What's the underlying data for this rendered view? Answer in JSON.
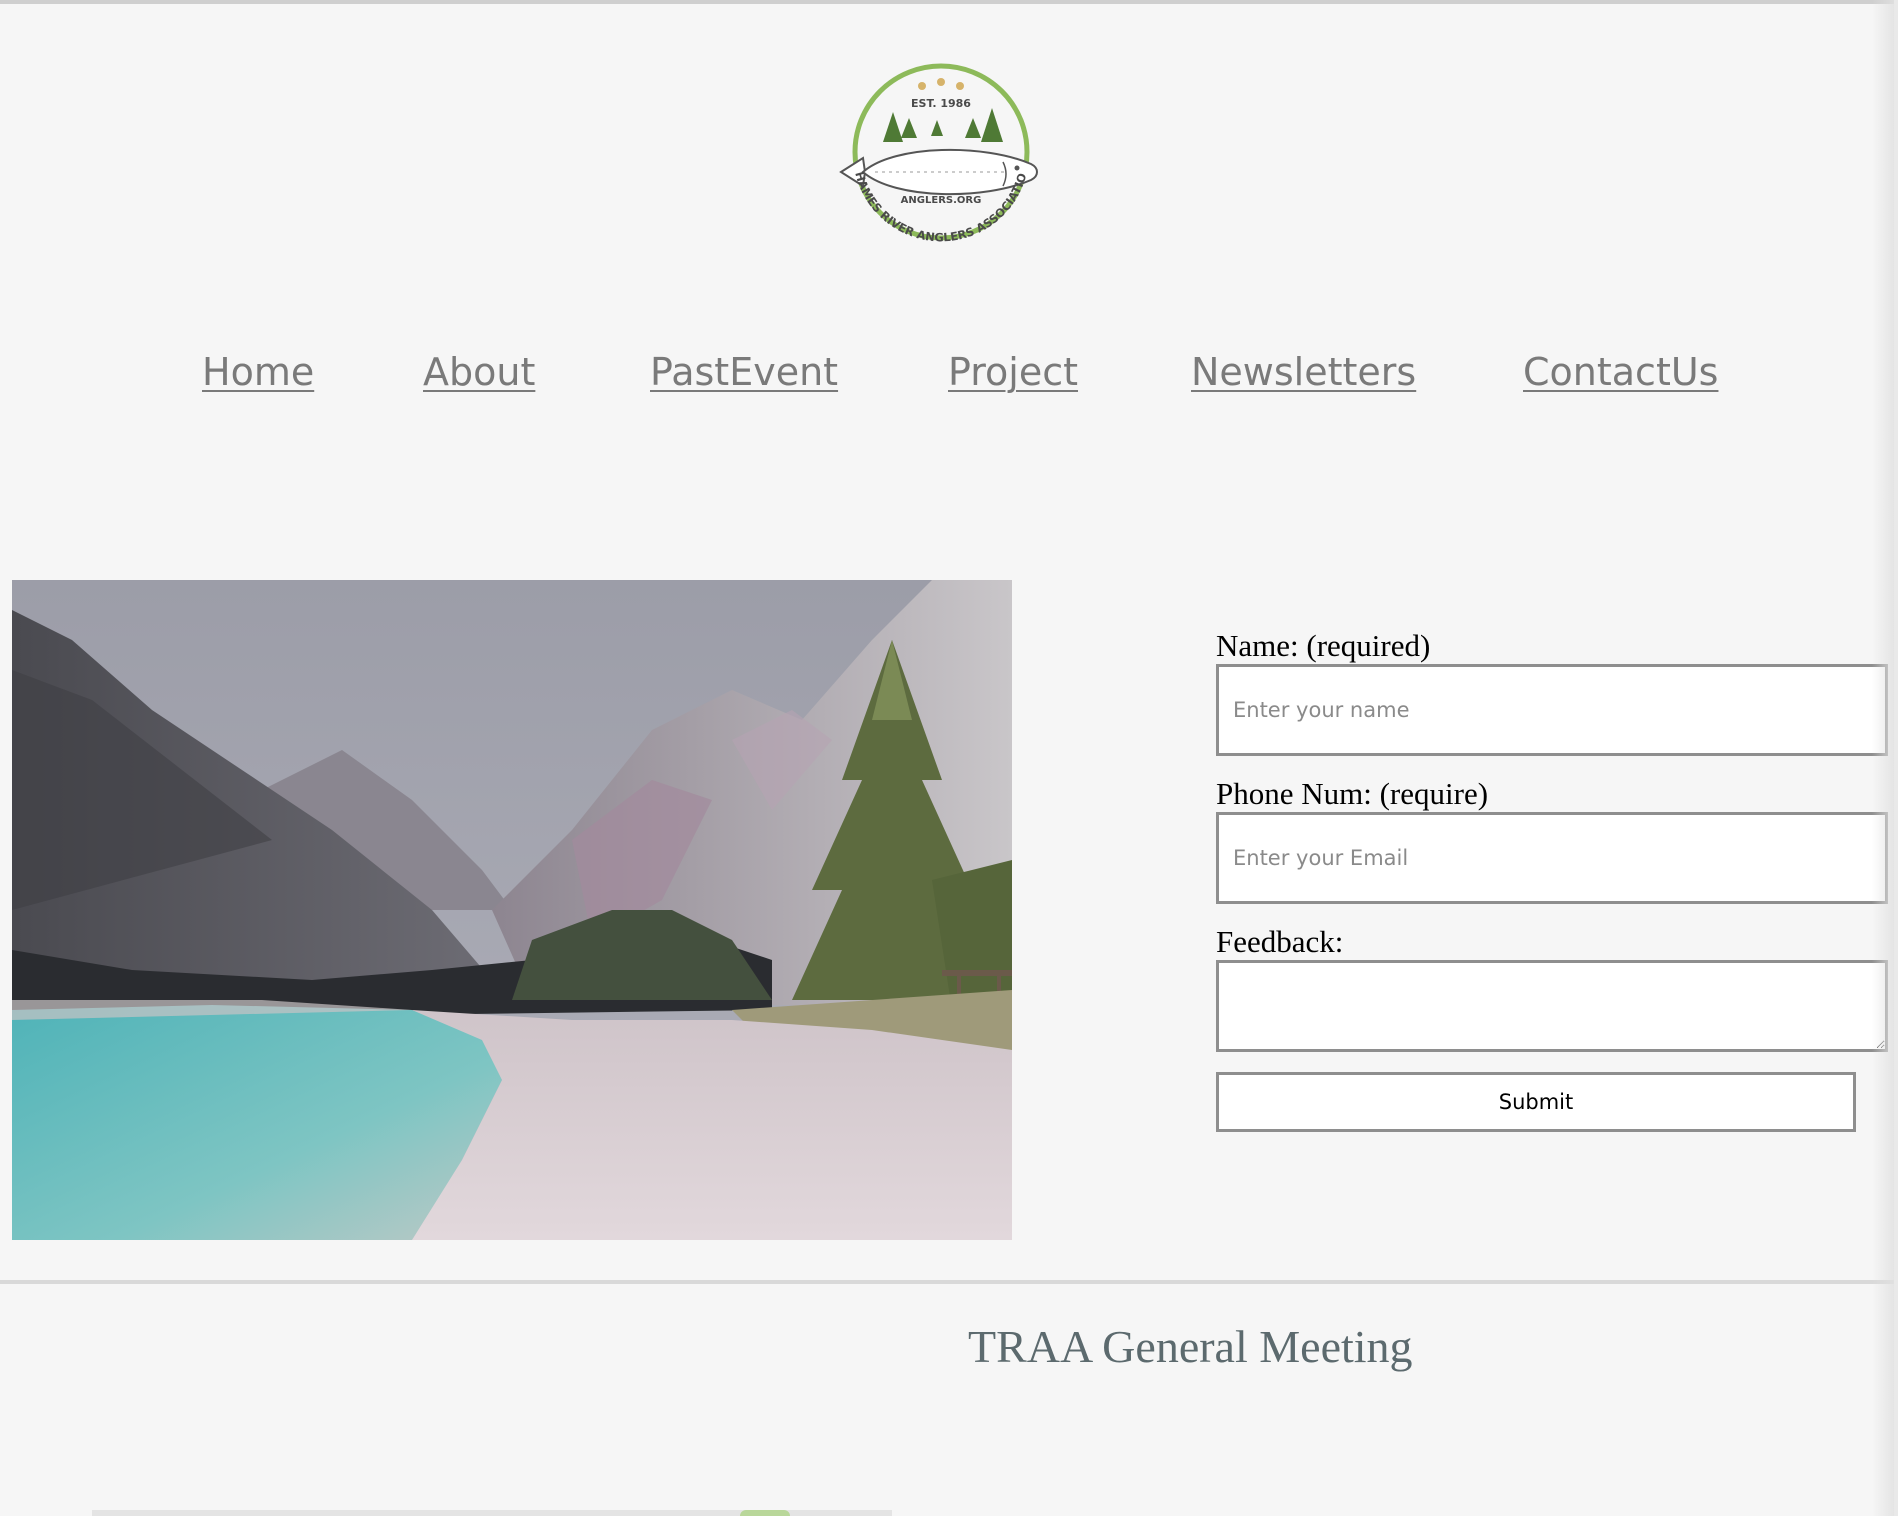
{
  "logo": {
    "est_text": "EST. 1986",
    "site_text": "ANGLERS.ORG",
    "ring_text": "THAMES RIVER ANGLERS ASSOCIATION",
    "ring_color": "#8dba5a",
    "tree_color": "#4f7a35"
  },
  "nav": {
    "items": [
      {
        "label": "Home"
      },
      {
        "label": "About"
      },
      {
        "label": "PastEvent"
      },
      {
        "label": "Project"
      },
      {
        "label": "Newsletters"
      },
      {
        "label": "ContactUs"
      }
    ]
  },
  "form": {
    "name_label": "Name: (required)",
    "name_placeholder": "Enter your name",
    "phone_label": "Phone Num: (require)",
    "phone_placeholder": "Enter your Email",
    "feedback_label": "Feedback:",
    "submit_label": "Submit"
  },
  "section": {
    "title": "TRAA General Meeting"
  },
  "colors": {
    "background": "#f6f6f6",
    "nav_link": "#7a7a7a",
    "heading": "#5c6a6e",
    "input_border": "#8e8e8e"
  }
}
